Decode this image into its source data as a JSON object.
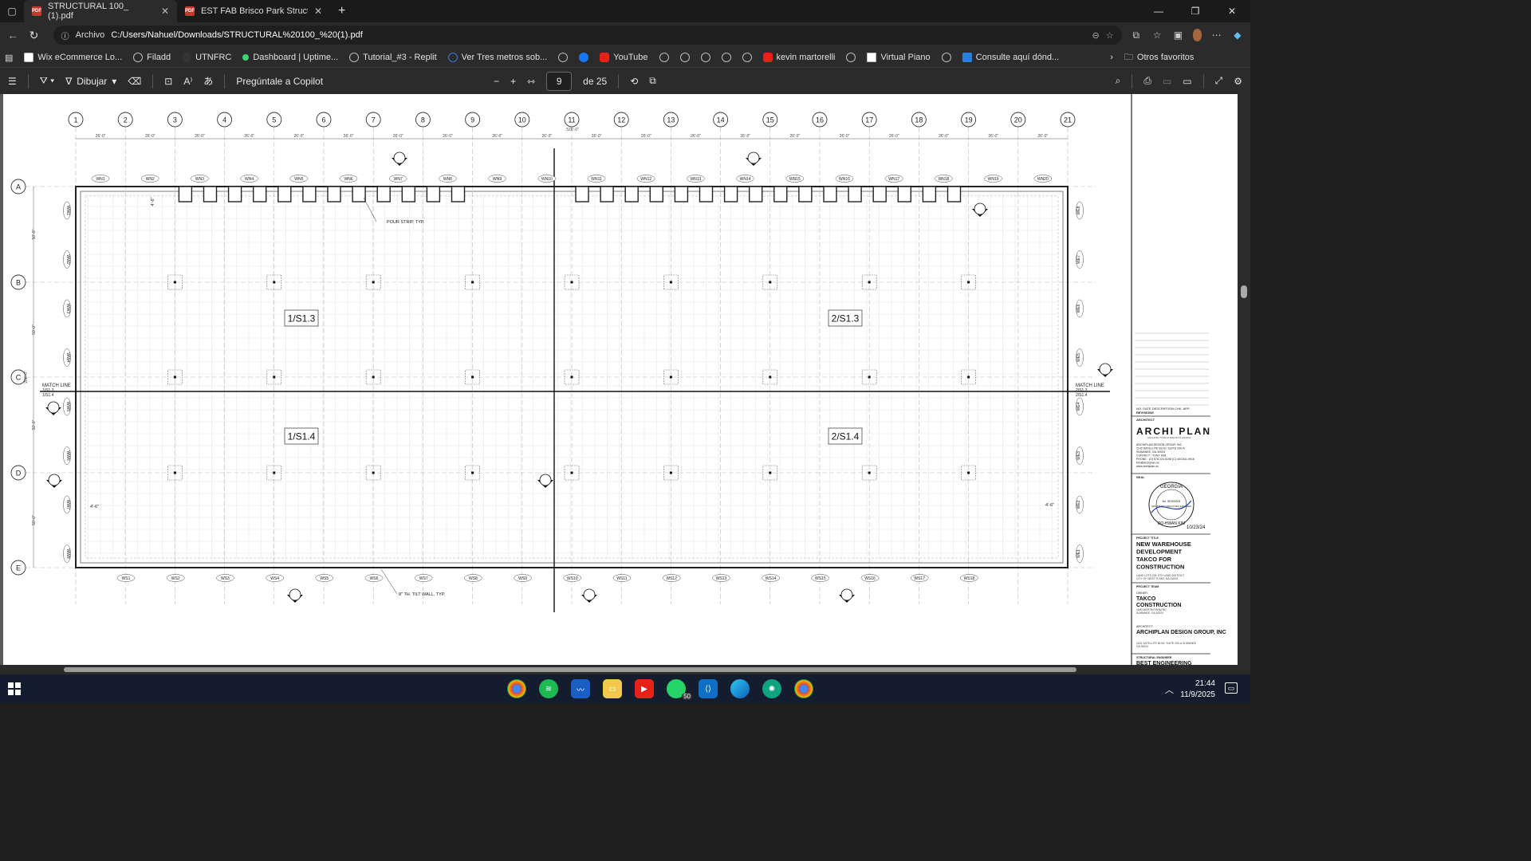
{
  "tabs": [
    {
      "label": "STRUCTURAL 100_ (1).pdf",
      "active": true
    },
    {
      "label": "EST FAB Brisco Park Structurals.pd",
      "active": false
    }
  ],
  "address": {
    "scheme": "Archivo",
    "url": "C:/Users/Nahuel/Downloads/STRUCTURAL%20100_%20(1).pdf"
  },
  "bookmarks": [
    {
      "label": "Wix eCommerce Lo...",
      "icon": "wix-icon"
    },
    {
      "label": "Filadd",
      "icon": "globe-icon"
    },
    {
      "label": "UTNFRC",
      "icon": "utn-icon"
    },
    {
      "label": "Dashboard | Uptime...",
      "icon": "uptime-icon"
    },
    {
      "label": "Tutorial_#3 - Replit",
      "icon": "replit-icon"
    },
    {
      "label": "Ver Tres metros sob...",
      "icon": "video-icon"
    },
    {
      "label": "",
      "icon": "globe-icon"
    },
    {
      "label": "",
      "icon": "facebook-icon"
    },
    {
      "label": "YouTube",
      "icon": "youtube-icon"
    },
    {
      "label": "",
      "icon": "globe-icon"
    },
    {
      "label": "",
      "icon": "globe-icon"
    },
    {
      "label": "",
      "icon": "globe-icon"
    },
    {
      "label": "",
      "icon": "globe-icon"
    },
    {
      "label": "",
      "icon": "globe-icon"
    },
    {
      "label": "kevin martorelli",
      "icon": "youtube-icon"
    },
    {
      "label": "",
      "icon": "globe-icon"
    },
    {
      "label": "Virtual Piano",
      "icon": "piano-icon"
    },
    {
      "label": "",
      "icon": "globe-icon"
    },
    {
      "label": "Consulte aquí dónd...",
      "icon": "chart-icon"
    }
  ],
  "other_bookmarks": "Otros favoritos",
  "pdf_toolbar": {
    "draw": "Dibujar",
    "copilot": "Pregúntale a Copilot",
    "page": "9",
    "page_total": "de 25",
    "zoom_minus": "−",
    "zoom_plus": "+"
  },
  "drawing": {
    "cols": [
      "1",
      "2",
      "3",
      "4",
      "5",
      "6",
      "7",
      "8",
      "9",
      "10",
      "11",
      "12",
      "13",
      "14",
      "15",
      "16",
      "17",
      "18",
      "19",
      "20",
      "21"
    ],
    "rows": [
      "A",
      "B",
      "C",
      "D",
      "E"
    ],
    "col_spacing": "26'-0\"",
    "total_width": "520'-0\"",
    "row_spacing": "50'-0\"",
    "total_height": "200'-0\"",
    "wn": [
      "WN1",
      "WN2",
      "WN3",
      "WN4",
      "WN5",
      "WN6",
      "WN7",
      "WN8",
      "WN9",
      "WN10",
      "WN11",
      "WN12",
      "WN13",
      "WN14",
      "WN15",
      "WN16",
      "WN17",
      "WN18",
      "WN19",
      "WN20"
    ],
    "ws": [
      "WS1",
      "WS2",
      "WS3",
      "WS4",
      "WS5",
      "WS6",
      "WS7",
      "WS8",
      "WS9",
      "WS10",
      "WS11",
      "WS12",
      "WS13",
      "WS14",
      "WS15",
      "WS16",
      "WS17",
      "WS18"
    ],
    "ww": [
      "WW1",
      "WW2",
      "WW3",
      "WW4",
      "WW5",
      "WW6",
      "WW7",
      "WW8"
    ],
    "we": [
      "WE8",
      "WE7",
      "WE6",
      "WE5",
      "WE4",
      "WE3",
      "WE2",
      "WE1"
    ],
    "match_refs": [
      "1/S1.3",
      "2/S1.3",
      "1/S1.4",
      "2/S1.4"
    ],
    "match_line": "MATCH LINE",
    "match_left": [
      "1/S1.3",
      "1/S1.4"
    ],
    "match_right": [
      "2/S1.3",
      "2/S1.4"
    ],
    "pour_strip": "POUR STRIP, TYP.",
    "tilt_wall": "8\" TH. TILT WALL, TYP.",
    "dim_4_6": "4'-6\""
  },
  "title_block": {
    "revisions_header": "NO.  DATE    DESCRIPTION    CHK. APP.",
    "revisions": "REVISIONS",
    "architect_label": "ARCHITECT",
    "arch_logo": "ARCHI PLAN",
    "arch_tagline": "ARCHITECTURE  INTERIOR  PLANNING",
    "arch_address": "ARCHIPLAN DESIGN GROUP, INC\n1142 SATELLITE BLVD. SUITE 200-A\nSUWANEE, GA 30024\nCONTACT : TONY KIM\nPHONE : (O) 678.224.5198 (C) 404.641.9916\nkim@archiplan.us\nwww.archiplan.us",
    "seal_label": "SEAL",
    "seal_state": "GEORGIA",
    "seal_no": "No. SE000203",
    "seal_title": "REGISTERED STRUCTURAL ENGINEER",
    "seal_name": "DO-HWAN KIM",
    "seal_date": "10/23/24",
    "project_title_label": "PROJECT TITLE",
    "project_title": "NEW WAREHOUSE DEVELOPMENT TAKCO FOR CONSTRUCTION",
    "project_address": "LAND LOTS 228, 8TH LAND DISTRICT\nCITY OF WEST POINT, GA 31833",
    "project_team_label": "PROJECT TEAM",
    "owner_label": "OWNER:",
    "owner": "TAKCO CONSTRUCTION",
    "owner_address": "1690 MARTIN FARM RD\nSUWANEE, GA 30024",
    "architect2_label": "ARCHITECT:",
    "architect2": "ARCHIPLAN DESIGN GROUP, INC",
    "architect2_address": "1142 SATELLITE BLVD. SUITE 200-A  SUWANEE,\nGA 30024",
    "structural_label": "STRUCTURAL ENGINEER",
    "structural": "BEST ENGINEERING"
  },
  "taskbar": {
    "time": "21:44",
    "date": "11/9/2025",
    "badge": "50"
  }
}
